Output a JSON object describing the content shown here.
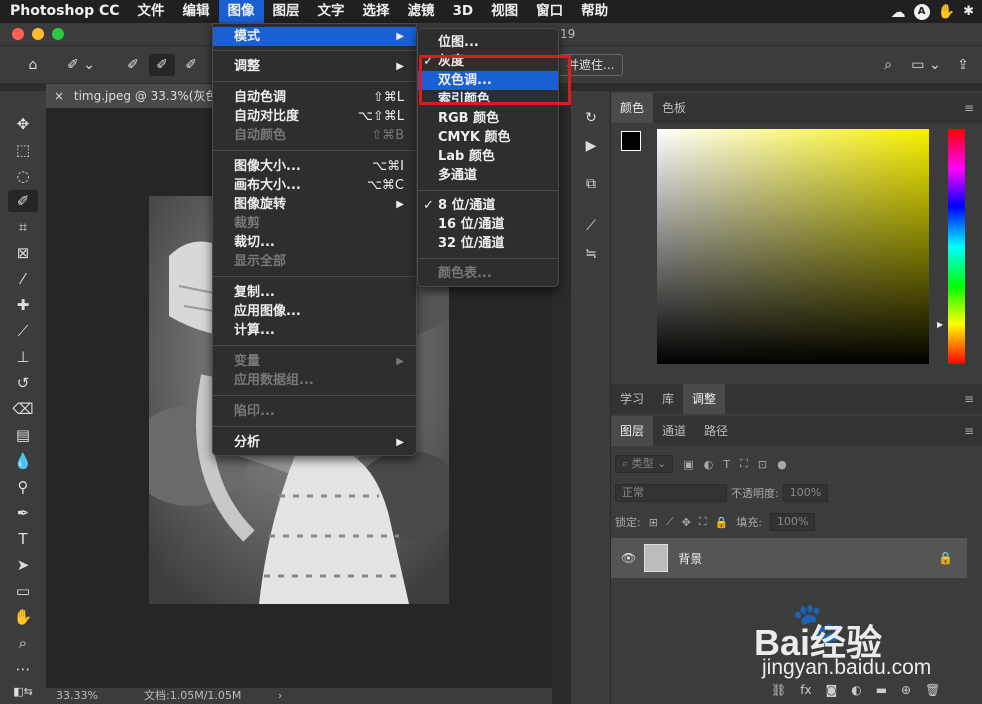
{
  "menubar": {
    "app": "Photoshop CC",
    "items": [
      "文件",
      "编辑",
      "图像",
      "图层",
      "文字",
      "选择",
      "滤镜",
      "3D",
      "视图",
      "窗口",
      "帮助"
    ],
    "active_index": 2,
    "profile_initial": "A"
  },
  "window": {
    "title_suffix": "19"
  },
  "options": {
    "mask_button": "并遮住..."
  },
  "document": {
    "tab_label": "timg.jpeg @ 33.3%(灰色/",
    "zoom": "33.33%",
    "doc_size": "文档:1.05M/1.05M"
  },
  "menu_image": {
    "items": [
      {
        "label": "模式",
        "submenu": true
      },
      {
        "label": "调整",
        "submenu": true
      },
      {
        "label": "自动色调",
        "shortcut": "⇧⌘L"
      },
      {
        "label": "自动对比度",
        "shortcut": "⌥⇧⌘L"
      },
      {
        "label": "自动颜色",
        "shortcut": "⇧⌘B",
        "disabled": true
      },
      {
        "label": "图像大小...",
        "shortcut": "⌥⌘I"
      },
      {
        "label": "画布大小...",
        "shortcut": "⌥⌘C"
      },
      {
        "label": "图像旋转",
        "submenu": true
      },
      {
        "label": "裁剪",
        "disabled": true
      },
      {
        "label": "裁切..."
      },
      {
        "label": "显示全部",
        "disabled": true
      },
      {
        "label": "复制..."
      },
      {
        "label": "应用图像..."
      },
      {
        "label": "计算..."
      },
      {
        "label": "变量",
        "submenu": true,
        "disabled": true
      },
      {
        "label": "应用数据组...",
        "disabled": true
      },
      {
        "label": "陷印...",
        "disabled": true
      },
      {
        "label": "分析",
        "submenu": true
      }
    ]
  },
  "menu_mode": {
    "items": [
      {
        "label": "位图..."
      },
      {
        "label": "灰度",
        "checked": true
      },
      {
        "label": "双色调...",
        "highlighted": true
      },
      {
        "label": "索引颜色"
      },
      {
        "label": "RGB 颜色"
      },
      {
        "label": "CMYK 颜色"
      },
      {
        "label": "Lab 颜色"
      },
      {
        "label": "多通道"
      },
      {
        "label": "8 位/通道",
        "checked": true
      },
      {
        "label": "16 位/通道"
      },
      {
        "label": "32 位/通道"
      },
      {
        "label": "颜色表...",
        "disabled": true
      }
    ]
  },
  "color_panel": {
    "tabs": [
      "颜色",
      "色板"
    ],
    "hue_color": "#f7f000"
  },
  "learn_panel": {
    "tabs": [
      "学习",
      "库",
      "调整"
    ]
  },
  "layers_panel": {
    "tabs": [
      "图层",
      "通道",
      "路径"
    ],
    "filter_label": "类型",
    "blend_mode": "正常",
    "opacity_label": "不透明度:",
    "opacity_value": "100%",
    "lock_label": "锁定:",
    "fill_label": "填充:",
    "fill_value": "100%",
    "layer_name": "背景"
  },
  "watermark": {
    "brand": "Bai经验",
    "url": "jingyan.baidu.com"
  },
  "colors": {
    "accent": "#1a5fd4",
    "highlight_box": "#e0191e"
  }
}
